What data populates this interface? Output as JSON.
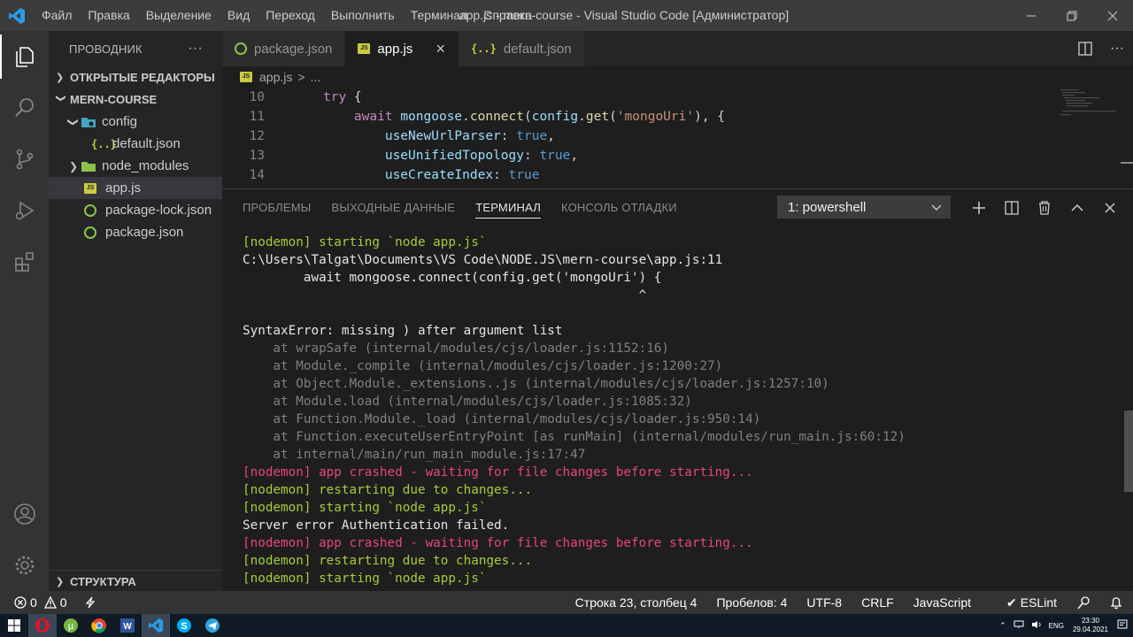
{
  "titlebar": {
    "menu": [
      "Файл",
      "Правка",
      "Выделение",
      "Вид",
      "Переход",
      "Выполнить",
      "Терминал",
      "Справка"
    ],
    "title": "app.js - mern-course - Visual Studio Code [Администратор]"
  },
  "sidebar": {
    "header": "ПРОВОДНИК",
    "more": "···",
    "open_editors": "ОТКРЫТЫЕ РЕДАКТОРЫ",
    "project": "MERN-COURSE",
    "tree": [
      {
        "label": "config",
        "type": "folder",
        "expanded": true
      },
      {
        "label": "default.json",
        "type": "json"
      },
      {
        "label": "node_modules",
        "type": "node-folder",
        "expanded": false
      },
      {
        "label": "app.js",
        "type": "js",
        "selected": true
      },
      {
        "label": "package-lock.json",
        "type": "node"
      },
      {
        "label": "package.json",
        "type": "node"
      }
    ],
    "structure": "СТРУКТУРА"
  },
  "tabs": [
    {
      "label": "package.json",
      "icon": "node-icon",
      "active": false
    },
    {
      "label": "app.js",
      "icon": "js-icon",
      "active": true,
      "close": "×"
    },
    {
      "label": "default.json",
      "icon": "json-icon",
      "active": false
    }
  ],
  "breadcrumb": {
    "file": "app.js",
    "sep": ">",
    "more": "..."
  },
  "code": [
    {
      "ln": "10",
      "indent": "",
      "parts": [
        [
          "kw",
          "try"
        ],
        [
          "pun",
          " {"
        ]
      ]
    },
    {
      "ln": "11",
      "indent": "    ",
      "parts": [
        [
          "kw",
          "await "
        ],
        [
          "var",
          "mongoose"
        ],
        [
          "pun",
          "."
        ],
        [
          "fn",
          "connect"
        ],
        [
          "pun",
          "("
        ],
        [
          "var",
          "config"
        ],
        [
          "pun",
          "."
        ],
        [
          "fn",
          "get"
        ],
        [
          "pun",
          "("
        ],
        [
          "str",
          "'mongoUri'"
        ],
        [
          "pun",
          "), {"
        ]
      ]
    },
    {
      "ln": "12",
      "indent": "        ",
      "parts": [
        [
          "var",
          "useNewUrlParser"
        ],
        [
          "pun",
          ": "
        ],
        [
          "ctl",
          "true"
        ],
        [
          "pun",
          ","
        ]
      ]
    },
    {
      "ln": "13",
      "indent": "        ",
      "parts": [
        [
          "var",
          "useUnifiedTopology"
        ],
        [
          "pun",
          ": "
        ],
        [
          "ctl",
          "true"
        ],
        [
          "pun",
          ","
        ]
      ]
    },
    {
      "ln": "14",
      "indent": "        ",
      "parts": [
        [
          "var",
          "useCreateIndex"
        ],
        [
          "pun",
          ": "
        ],
        [
          "ctl",
          "true"
        ]
      ]
    }
  ],
  "panel": {
    "tabs": [
      "ПРОБЛЕМЫ",
      "ВЫХОДНЫЕ ДАННЫЕ",
      "ТЕРМИНАЛ",
      "КОНСОЛЬ ОТЛАДКИ"
    ],
    "active_tab": "ТЕРМИНАЛ",
    "terminal_select": "1: powershell",
    "lines": [
      {
        "t": "[nodemon] starting `node app.js`",
        "c": "nodemon-g"
      },
      {
        "t": "C:\\Users\\Talgat\\Documents\\VS Code\\NODE.JS\\mern-course\\app.js:11",
        "c": "white"
      },
      {
        "t": "        await mongoose.connect(config.get('mongoUri') {",
        "c": "white"
      },
      {
        "t": "                                                    ^",
        "c": "white"
      },
      {
        "t": "",
        "c": "white"
      },
      {
        "t": "SyntaxError: missing ) after argument list",
        "c": "white"
      },
      {
        "t": "    at wrapSafe (internal/modules/cjs/loader.js:1152:16)",
        "c": "dim"
      },
      {
        "t": "    at Module._compile (internal/modules/cjs/loader.js:1200:27)",
        "c": "dim"
      },
      {
        "t": "    at Object.Module._extensions..js (internal/modules/cjs/loader.js:1257:10)",
        "c": "dim"
      },
      {
        "t": "    at Module.load (internal/modules/cjs/loader.js:1085:32)",
        "c": "dim"
      },
      {
        "t": "    at Function.Module._load (internal/modules/cjs/loader.js:950:14)",
        "c": "dim"
      },
      {
        "t": "    at Function.executeUserEntryPoint [as runMain] (internal/modules/run_main.js:60:12)",
        "c": "dim"
      },
      {
        "t": "    at internal/main/run_main_module.js:17:47",
        "c": "dim"
      },
      {
        "t": "[nodemon] app crashed - waiting for file changes before starting...",
        "c": "red"
      },
      {
        "t": "[nodemon] restarting due to changes...",
        "c": "nodemon-g"
      },
      {
        "t": "[nodemon] starting `node app.js`",
        "c": "nodemon-g"
      },
      {
        "t": "Server error Authentication failed.",
        "c": "white"
      },
      {
        "t": "[nodemon] app crashed - waiting for file changes before starting...",
        "c": "red"
      },
      {
        "t": "[nodemon] restarting due to changes...",
        "c": "nodemon-g"
      },
      {
        "t": "[nodemon] starting `node app.js`",
        "c": "nodemon-g"
      }
    ]
  },
  "statusbar": {
    "errors": "0",
    "warnings": "0",
    "position": "Строка 23, столбец 4",
    "spaces": "Пробелов: 4",
    "encoding": "UTF-8",
    "eol": "CRLF",
    "language": "JavaScript",
    "linter": "ESLint"
  },
  "taskbar": {
    "lang": "ENG",
    "time": "23:30",
    "date": "29.04.2021"
  },
  "colors": {
    "accent": "#007acc",
    "nodemon_green": "#a4cc3a",
    "error_red": "#e8457a"
  }
}
